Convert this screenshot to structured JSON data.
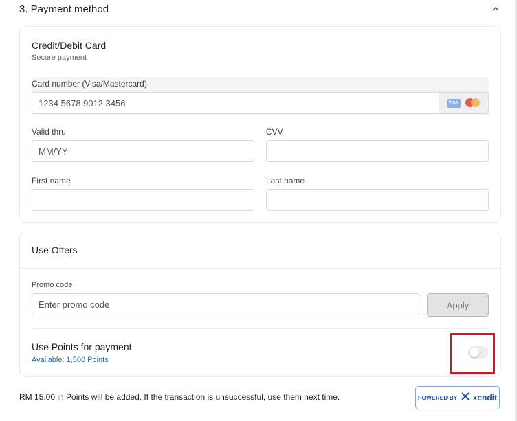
{
  "section": {
    "title": "3. Payment method"
  },
  "card_payment": {
    "title": "Credit/Debit Card",
    "subtitle": "Secure payment",
    "card_number_label": "Card number (Visa/Mastercard)",
    "card_number_placeholder": "1234 5678 9012 3456",
    "valid_thru_label": "Valid thru",
    "valid_thru_placeholder": "MM/YY",
    "cvv_label": "CVV",
    "cvv_placeholder": "",
    "first_name_label": "First name",
    "first_name_placeholder": "",
    "last_name_label": "Last name",
    "last_name_placeholder": "",
    "visa_text": "VISA"
  },
  "offers": {
    "title": "Use Offers",
    "promo_label": "Promo code",
    "promo_placeholder": "Enter promo code",
    "apply_label": "Apply",
    "points_title": "Use Points for payment",
    "points_available": "Available: 1,500 Points",
    "points_toggle_on": false
  },
  "footer": {
    "note": "RM 15.00 in Points will be added. If the transaction is unsuccessful, use them next time.",
    "powered_by": "POWERED BY",
    "provider": "xendit"
  },
  "colors": {
    "accent_link": "#1f6fb2",
    "highlight_box": "#d6161f",
    "xendit_blue": "#1e4fa0"
  },
  "icons": [
    "chevron-up-icon",
    "visa-logo-icon",
    "mastercard-logo-icon",
    "xendit-logo-icon"
  ]
}
